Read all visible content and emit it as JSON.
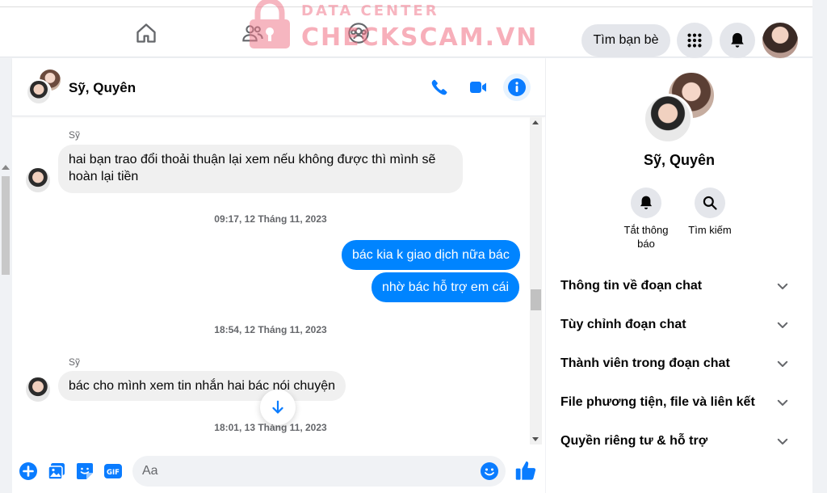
{
  "watermark": {
    "top": "DATA CENTER",
    "main": "CHECKSCAM.VN"
  },
  "topnav": {
    "find_friends": "Tìm bạn bè",
    "icons": [
      "home-icon",
      "friends-icon",
      "groups-icon",
      "menu-grid-icon",
      "bell-icon"
    ]
  },
  "chat": {
    "title": "Sỹ, Quyên",
    "header_icons": [
      "phone-icon",
      "video-icon",
      "info-icon"
    ],
    "messages": [
      {
        "type": "in",
        "sender": "Sỹ",
        "text_line1": "hai bạn trao đổi thoải thuận lại xem nếu không được thì mình sẽ",
        "text_line2": "hoàn lại tiền"
      },
      {
        "type": "time",
        "text": "09:17, 12 Tháng 11, 2023"
      },
      {
        "type": "out",
        "text": "bác kia k giao dịch nữa bác"
      },
      {
        "type": "out",
        "text": "nhờ bác hỗ trợ em cái"
      },
      {
        "type": "time",
        "text": "18:54, 12 Tháng 11, 2023"
      },
      {
        "type": "in",
        "sender": "Sỹ",
        "text": "bác cho mình xem tin nhắn hai bác nói chuyện"
      },
      {
        "type": "time",
        "text": "18:01, 13 Tháng 11, 2023"
      }
    ],
    "composer": {
      "placeholder": "Aa",
      "gif_label": "GIF",
      "icons": [
        "plus-icon",
        "image-icon",
        "sticker-icon",
        "gif-icon",
        "emoji-icon",
        "like-icon"
      ]
    }
  },
  "info_panel": {
    "name": "Sỹ, Quyên",
    "actions": [
      {
        "icon": "bell-icon",
        "label": "Tắt thông báo"
      },
      {
        "icon": "search-icon",
        "label": "Tìm kiếm"
      }
    ],
    "sections": [
      "Thông tin về đoạn chat",
      "Tùy chỉnh đoạn chat",
      "Thành viên trong đoạn chat",
      "File phương tiện, file và liên kết",
      "Quyền riêng tư & hỗ trợ"
    ]
  },
  "colors": {
    "accent": "#0084ff",
    "icon_blue": "#0a7cff",
    "bubble_in": "#f0f0f0"
  }
}
